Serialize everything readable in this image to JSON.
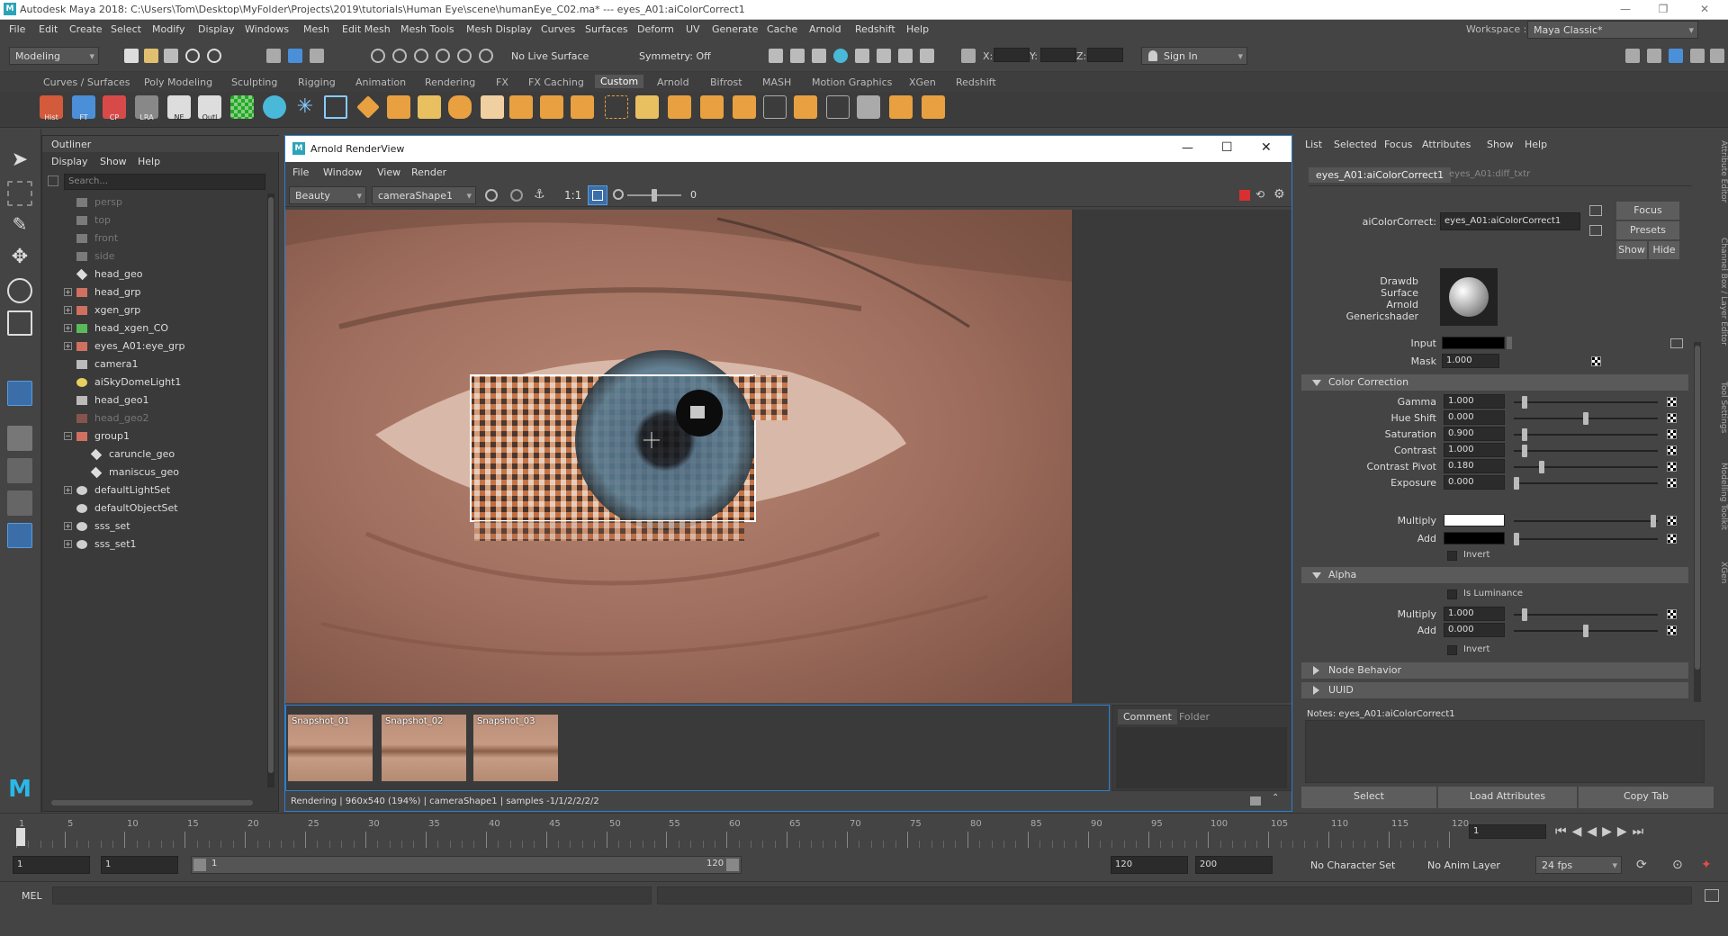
{
  "window": {
    "title": "Autodesk Maya 2018: C:\\Users\\Tom\\Desktop\\MyFolder\\Projects\\2019\\tutorials\\Human Eye\\scene\\humanEye_C02.ma*   ---   eyes_A01:aiColorCorrect1",
    "controls": [
      "—",
      "❐",
      "✕"
    ]
  },
  "menubar": [
    "File",
    "Edit",
    "Create",
    "Select",
    "Modify",
    "Display",
    "Windows",
    "Mesh",
    "Edit Mesh",
    "Mesh Tools",
    "Mesh Display",
    "Curves",
    "Surfaces",
    "Deform",
    "UV",
    "Generate",
    "Cache",
    "Arnold",
    "Redshift",
    "Help"
  ],
  "workspace": {
    "label": "Workspace :",
    "value": "Maya Classic*"
  },
  "statusline": {
    "mode": "Modeling",
    "live_surface": "No Live Surface",
    "symmetry": "Symmetry: Off",
    "x_label": "X:",
    "y_label": "Y:",
    "z_label": "Z:",
    "sign_in": "Sign In"
  },
  "shelf_tabs": [
    "Curves / Surfaces",
    "Poly Modeling",
    "Sculpting",
    "Rigging",
    "Animation",
    "Rendering",
    "FX",
    "FX Caching",
    "Custom",
    "Arnold",
    "Bifrost",
    "MASH",
    "Motion Graphics",
    "XGen",
    "Redshift"
  ],
  "shelf_active": "Custom",
  "shelf_labeled": [
    {
      "label": "Hist",
      "color": "#d35a3a"
    },
    {
      "label": "FT",
      "color": "#4a8fd8"
    },
    {
      "label": "CP",
      "color": "#d84a4a"
    },
    {
      "label": "LRA",
      "color": "#888888"
    },
    {
      "label": "NE",
      "color": "#dddddd"
    },
    {
      "label": "Outl",
      "color": "#dddddd"
    }
  ],
  "outliner": {
    "title": "Outliner",
    "menu": [
      "Display",
      "Show",
      "Help"
    ],
    "search_placeholder": "Search...",
    "items": [
      {
        "name": "persp",
        "type": "camera",
        "expand": "",
        "dim": true
      },
      {
        "name": "top",
        "type": "camera",
        "expand": "",
        "dim": true
      },
      {
        "name": "front",
        "type": "camera",
        "expand": "",
        "dim": true
      },
      {
        "name": "side",
        "type": "camera",
        "expand": "",
        "dim": true
      },
      {
        "name": "head_geo",
        "type": "mesh",
        "expand": "",
        "dim": false
      },
      {
        "name": "head_grp",
        "type": "group",
        "expand": "+",
        "dim": false
      },
      {
        "name": "xgen_grp",
        "type": "group",
        "expand": "+",
        "dim": false
      },
      {
        "name": "head_xgen_CO",
        "type": "xgen",
        "expand": "+",
        "dim": false
      },
      {
        "name": "eyes_A01:eye_grp",
        "type": "group",
        "expand": "+",
        "dim": false
      },
      {
        "name": "camera1",
        "type": "camera",
        "expand": "",
        "dim": false
      },
      {
        "name": "aiSkyDomeLight1",
        "type": "light",
        "expand": "",
        "dim": false
      },
      {
        "name": "head_geo1",
        "type": "camera",
        "expand": "",
        "dim": false
      },
      {
        "name": "head_geo2",
        "type": "group",
        "expand": "",
        "dim": true
      },
      {
        "name": "group1",
        "type": "group",
        "expand": "−",
        "dim": false
      },
      {
        "name": "caruncle_geo",
        "type": "mesh",
        "expand": "",
        "dim": false,
        "indent": true
      },
      {
        "name": "maniscus_geo",
        "type": "mesh",
        "expand": "",
        "dim": false,
        "indent": true
      },
      {
        "name": "defaultLightSet",
        "type": "set",
        "expand": "+",
        "dim": false
      },
      {
        "name": "defaultObjectSet",
        "type": "set",
        "expand": "",
        "dim": false
      },
      {
        "name": "sss_set",
        "type": "set",
        "expand": "+",
        "dim": false
      },
      {
        "name": "sss_set1",
        "type": "set",
        "expand": "+",
        "dim": false
      }
    ]
  },
  "renderview": {
    "title": "Arnold RenderView",
    "controls": [
      "—",
      "☐",
      "✕"
    ],
    "menu": [
      "File",
      "Window",
      "View",
      "Render"
    ],
    "aov": "Beauty",
    "camera": "cameraShape1",
    "ratio": "1:1",
    "exposure": "0",
    "snapshots": [
      "Snapshot_01",
      "Snapshot_02",
      "Snapshot_03"
    ],
    "tabs": [
      "Comment",
      "Folder"
    ],
    "status": "Rendering | 960x540 (194%) | cameraShape1 | samples -1/1/2/2/2/2"
  },
  "attribute_editor": {
    "menu": [
      "List",
      "Selected",
      "Focus",
      "Attributes",
      "Show",
      "Help"
    ],
    "tabs": [
      "eyes_A01:aiColorCorrect1",
      "eyes_A01:diff_txtr"
    ],
    "node_label": "aiColorCorrect:",
    "node_value": "eyes_A01:aiColorCorrect1",
    "buttons": {
      "focus": "Focus",
      "presets": "Presets",
      "show": "Show",
      "hide": "Hide"
    },
    "swatch_label": [
      "Drawdb",
      "Surface",
      "Arnold",
      "Genericshader"
    ],
    "input_label": "Input",
    "mask_label": "Mask",
    "mask_value": "1.000",
    "color_correction": {
      "title": "Color Correction",
      "rows": [
        {
          "label": "Gamma",
          "value": "1.000",
          "pos": 0.06
        },
        {
          "label": "Hue Shift",
          "value": "0.000",
          "pos": 0.5
        },
        {
          "label": "Saturation",
          "value": "0.900",
          "pos": 0.06
        },
        {
          "label": "Contrast",
          "value": "1.000",
          "pos": 0.06
        },
        {
          "label": "Contrast Pivot",
          "value": "0.180",
          "pos": 0.18
        },
        {
          "label": "Exposure",
          "value": "0.000",
          "pos": 0.0
        }
      ],
      "multiply_label": "Multiply",
      "multiply_color": "#ffffff",
      "add_label": "Add",
      "add_color": "#000000",
      "invert_label": "Invert"
    },
    "alpha": {
      "title": "Alpha",
      "is_luminance": "Is Luminance",
      "rows": [
        {
          "label": "Multiply",
          "value": "1.000",
          "pos": 0.06
        },
        {
          "label": "Add",
          "value": "0.000",
          "pos": 0.5
        }
      ],
      "invert_label": "Invert"
    },
    "node_behavior": "Node Behavior",
    "uuid": "UUID",
    "notes": "Notes:  eyes_A01:aiColorCorrect1",
    "bottom_buttons": [
      "Select",
      "Load Attributes",
      "Copy Tab"
    ],
    "side_tabs": [
      "Attribute Editor",
      "Channel Box / Layer Editor",
      "Tool Settings",
      "Modelling Toolkit",
      "XGen"
    ]
  },
  "timeline": {
    "ticks": [
      "1",
      "5",
      "10",
      "15",
      "20",
      "25",
      "30",
      "35",
      "40",
      "45",
      "50",
      "55",
      "60",
      "65",
      "70",
      "75",
      "80",
      "85",
      "90",
      "95",
      "100",
      "105",
      "110",
      "115",
      "120"
    ],
    "current_frame": "1"
  },
  "range": {
    "start": "1",
    "anim_start": "1",
    "slider_start": "1",
    "slider_end": "120",
    "end": "120",
    "anim_end": "200",
    "character_set": "No Character Set",
    "anim_layer": "No Anim Layer",
    "fps": "24 fps"
  },
  "cmdline": {
    "label": "MEL"
  }
}
